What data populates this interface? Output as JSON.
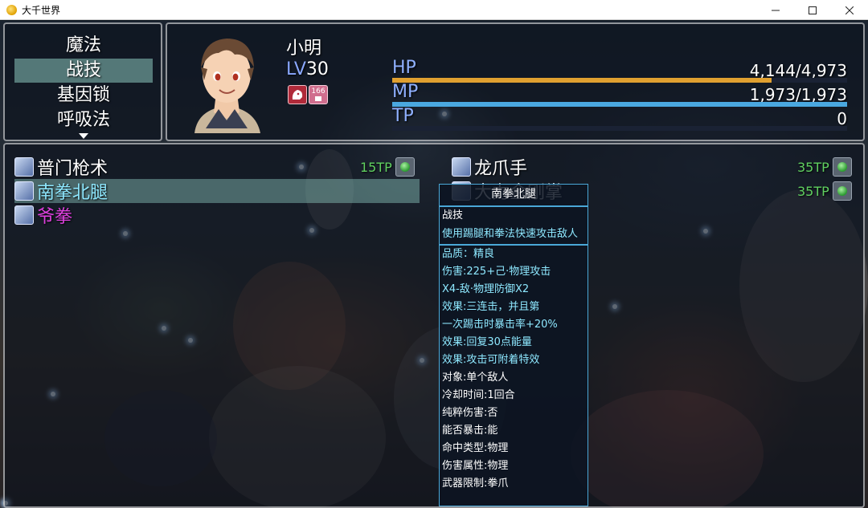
{
  "window": {
    "title": "大千世界"
  },
  "command_menu": {
    "items": [
      {
        "label": "魔法",
        "selected": false
      },
      {
        "label": "战技",
        "selected": true
      },
      {
        "label": "基因锁",
        "selected": false
      },
      {
        "label": "呼吸法",
        "selected": false
      }
    ]
  },
  "actor": {
    "name": "小明",
    "level_tag": "LV",
    "level": "30",
    "state_badge": "166",
    "hp": {
      "label": "HP",
      "value": "4,144/4,973",
      "ratio": 0.8333
    },
    "mp": {
      "label": "MP",
      "value": "1,973/1,973",
      "ratio": 1.0
    },
    "tp": {
      "label": "TP",
      "value": "0",
      "ratio": 0
    }
  },
  "skills": [
    {
      "name": "普门枪术",
      "cost": "15TP",
      "selected": false,
      "color": "#ffffff"
    },
    {
      "name": "南拳北腿",
      "cost": "",
      "selected": true,
      "color": "#8ee8ff"
    },
    {
      "name": "爷拳",
      "cost": "",
      "selected": false,
      "color": "#e040e0"
    },
    {
      "name": "龙爪手",
      "cost": "35TP",
      "selected": false,
      "color": "#ffffff"
    },
    {
      "name": "大力金刚掌",
      "cost": "35TP",
      "selected": false,
      "color": "#ffffff"
    }
  ],
  "tooltip": {
    "title": "南拳北腿",
    "type": "战技",
    "description": "使用踢腿和拳法快速攻击敌人",
    "lines": [
      {
        "text": "品质：精良",
        "color": "#8ee8ff"
      },
      {
        "text": "伤害:225+己·物理攻击",
        "color": "#8ee8ff"
      },
      {
        "text": "X4-敌·物理防御X2",
        "color": "#8ee8ff"
      },
      {
        "text": "效果:三连击，并且第",
        "color": "#8ee8ff"
      },
      {
        "text": "一次踢击时暴击率+20%",
        "color": "#8ee8ff"
      },
      {
        "text": "效果:回复30点能量",
        "color": "#8ee8ff"
      },
      {
        "text": "效果:攻击可附着特效",
        "color": "#8ee8ff"
      },
      {
        "text": "对象:单个敌人",
        "color": "#ffffff"
      },
      {
        "text": "冷却时间:1回合",
        "color": "#ffffff"
      },
      {
        "text": "纯粹伤害:否",
        "color": "#ffffff"
      },
      {
        "text": "能否暴击:能",
        "color": "#ffffff"
      },
      {
        "text": "命中类型:物理",
        "color": "#ffffff"
      },
      {
        "text": "伤害属性:物理",
        "color": "#ffffff"
      },
      {
        "text": "武器限制:拳爪",
        "color": "#ffffff"
      }
    ]
  },
  "colors": {
    "hp_gauge": "#e0a030",
    "mp_gauge": "#4aa8e0",
    "tp_gauge": "#2a3a6a",
    "tp_cost": "#60d060"
  }
}
